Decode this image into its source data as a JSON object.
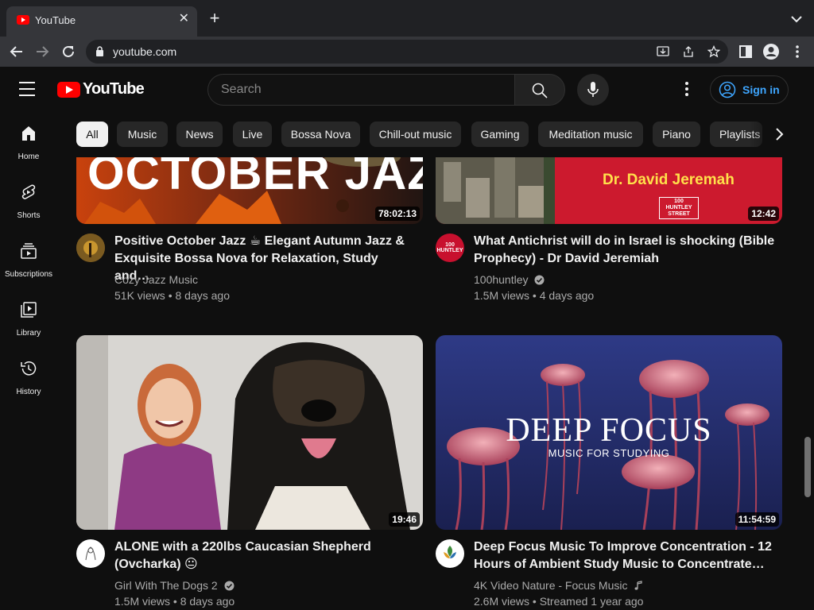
{
  "browser": {
    "tab_title": "YouTube",
    "tab_close": "✕",
    "new_tab": "+",
    "url": "youtube.com"
  },
  "header": {
    "logo_text": "YouTube",
    "search_placeholder": "Search",
    "sign_in": "Sign in"
  },
  "sidebar": {
    "items": [
      {
        "label": "Home",
        "icon": "home-icon"
      },
      {
        "label": "Shorts",
        "icon": "shorts-icon"
      },
      {
        "label": "Subscriptions",
        "icon": "subscriptions-icon"
      },
      {
        "label": "Library",
        "icon": "library-icon"
      },
      {
        "label": "History",
        "icon": "history-icon"
      }
    ]
  },
  "chips": [
    "All",
    "Music",
    "News",
    "Live",
    "Bossa Nova",
    "Chill-out music",
    "Gaming",
    "Meditation music",
    "Piano",
    "Playlists"
  ],
  "videos": [
    {
      "title_line1": "Positive October Jazz ☕ Elegant Autumn Jazz &",
      "title_line2": "Exquisite Bossa Nova for Relaxation, Study and…",
      "channel": "Cozy Jazz Music",
      "meta": "51K views • 8 days ago",
      "duration": "78:02:13",
      "thumb_text": "OCTOBER JAZZ"
    },
    {
      "title_line1": "What Antichrist will do in Israel is shocking (Bible",
      "title_line2": "Prophecy) - Dr David Jeremiah",
      "channel": "100huntley",
      "meta": "1.5M views • 4 days ago",
      "duration": "12:42",
      "thumb_text": "Dr. David Jeremah",
      "thumb_badge": "100 HUNTLEY STREET",
      "avatar_text": "100 HUNTLEY"
    },
    {
      "title_line1": "ALONE with a 220lbs Caucasian Shepherd",
      "title_line2": "(Ovcharka) 😐",
      "channel": "Girl With The Dogs 2",
      "meta": "1.5M views • 8 days ago",
      "duration": "19:46"
    },
    {
      "title_line1": "Deep Focus Music To Improve Concentration - 12",
      "title_line2": "Hours of Ambient Study Music to Concentrate…",
      "channel": "4K Video Nature - Focus Music",
      "meta": "2.6M views • Streamed 1 year ago",
      "duration": "11:54:59",
      "thumb_text": "DEEP FOCUS",
      "thumb_subtext": "MUSIC FOR STUDYING"
    }
  ],
  "colors": {
    "background": "#0f0f0f",
    "brand_red": "#ff0000",
    "link_blue": "#3ea6ff",
    "chip_bg": "#272727"
  }
}
